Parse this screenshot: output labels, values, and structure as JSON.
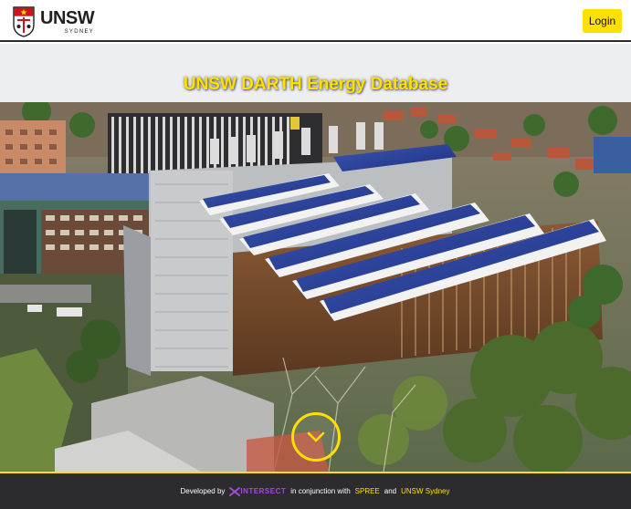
{
  "header": {
    "logo_main": "UNSW",
    "logo_sub": "SYDNEY",
    "login_label": "Login"
  },
  "hero": {
    "title": "UNSW DARTH Energy Database"
  },
  "footer": {
    "developed_by": "Developed by",
    "brand": "INTERSECT",
    "in_conjunction": "in conjunction with",
    "spree": "SPREE",
    "and": "and",
    "unsw_sydney": "UNSW Sydney"
  },
  "colors": {
    "accent": "#ffe000",
    "footer_bg": "#2c2c2e",
    "band_bg": "#eceeef",
    "brand_purple": "#a14bd8"
  },
  "icons": {
    "scroll": "chevron-down-icon",
    "crest": "unsw-crest-icon"
  }
}
